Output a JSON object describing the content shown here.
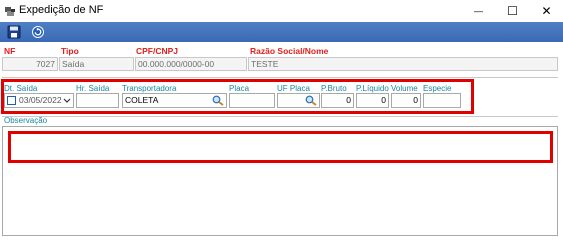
{
  "window": {
    "title": "Expedição de NF",
    "minimize": "—",
    "maximize": "☐",
    "close": "✕"
  },
  "toolbar": {
    "save_icon": "save-icon",
    "refresh_icon": "refresh-icon"
  },
  "header": {
    "nf_label": "NF",
    "nf_value": "7027",
    "tipo_label": "Tipo",
    "tipo_value": "Saída",
    "cpf_label": "CPF/CNPJ",
    "cpf_value": "00.000.000/0000-00",
    "razao_label": "Razão Social/Nome",
    "razao_value": "TESTE"
  },
  "shipping": {
    "dt_saida_label": "Dt. Saída",
    "dt_saida_value": "03/05/2022",
    "hr_saida_label": "Hr. Saída",
    "hr_saida_value": "",
    "transportadora_label": "Transportadora",
    "transportadora_value": "COLETA",
    "placa_label": "Placa",
    "placa_value": "",
    "uf_placa_label": "UF Placa",
    "uf_placa_value": "",
    "pbruto_label": "P.Bruto",
    "pbruto_value": "0",
    "pliquido_label": "P.Líquido",
    "pliquido_value": "0",
    "volume_label": "Volume",
    "volume_value": "0",
    "especie_label": "Especie",
    "especie_value": ""
  },
  "notes": {
    "label": "Observação",
    "value": ""
  },
  "colors": {
    "highlight": "#e00000",
    "toolbar": "#3a6ab4",
    "label_red": "#e02020",
    "label_teal": "#1a86a0"
  }
}
